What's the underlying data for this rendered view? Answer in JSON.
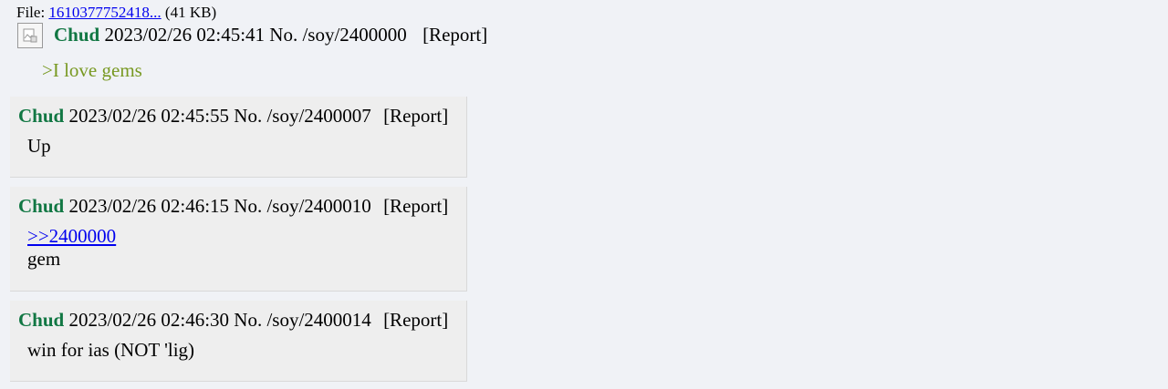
{
  "op": {
    "file_prefix": "File:",
    "file_name": "1610377752418...",
    "file_size": "(41 KB)",
    "thumbnail_icon": "broken-image-icon",
    "name": "Chud",
    "datetime": "2023/02/26 02:45:41",
    "post_no": "No. /soy/2400000",
    "report_label": "[Report]",
    "body": ">I love gems"
  },
  "replies": [
    {
      "name": "Chud",
      "datetime": "2023/02/26 02:45:55",
      "post_no": "No. /soy/2400007",
      "report_label": "[Report]",
      "quote": "",
      "body": "Up"
    },
    {
      "name": "Chud",
      "datetime": "2023/02/26 02:46:15",
      "post_no": "No. /soy/2400010",
      "report_label": "[Report]",
      "quote": ">>2400000",
      "body": "gem"
    },
    {
      "name": "Chud",
      "datetime": "2023/02/26 02:46:30",
      "post_no": "No. /soy/2400014",
      "report_label": "[Report]",
      "quote": "",
      "body": "win for ias (NOT 'lig)"
    }
  ],
  "colors": {
    "name": "#117743",
    "greentext": "#789922",
    "link": "#0000ee",
    "reply_bg": "#eeeeee",
    "page_bg": "#f0f2f6"
  }
}
